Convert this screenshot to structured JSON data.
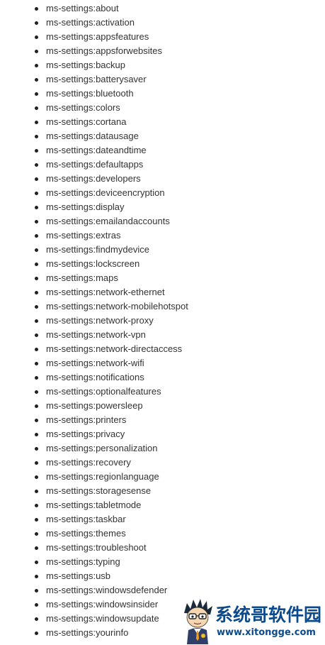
{
  "settings_uris": [
    "ms-settings:about",
    "ms-settings:activation",
    "ms-settings:appsfeatures",
    "ms-settings:appsforwebsites",
    "ms-settings:backup",
    "ms-settings:batterysaver",
    "ms-settings:bluetooth",
    "ms-settings:colors",
    "ms-settings:cortana",
    "ms-settings:datausage",
    "ms-settings:dateandtime",
    "ms-settings:defaultapps",
    "ms-settings:developers",
    "ms-settings:deviceencryption",
    "ms-settings:display",
    "ms-settings:emailandaccounts",
    "ms-settings:extras",
    "ms-settings:findmydevice",
    "ms-settings:lockscreen",
    "ms-settings:maps",
    "ms-settings:network-ethernet",
    "ms-settings:network-mobilehotspot",
    "ms-settings:network-proxy",
    "ms-settings:network-vpn",
    "ms-settings:network-directaccess",
    "ms-settings:network-wifi",
    "ms-settings:notifications",
    "ms-settings:optionalfeatures",
    "ms-settings:powersleep",
    "ms-settings:printers",
    "ms-settings:privacy",
    "ms-settings:personalization",
    "ms-settings:recovery",
    "ms-settings:regionlanguage",
    "ms-settings:storagesense",
    "ms-settings:tabletmode",
    "ms-settings:taskbar",
    "ms-settings:themes",
    "ms-settings:troubleshoot",
    "ms-settings:typing",
    "ms-settings:usb",
    "ms-settings:windowsdefender",
    "ms-settings:windowsinsider",
    "ms-settings:windowsupdate",
    "ms-settings:yourinfo"
  ],
  "watermark": {
    "brand_name": "系统哥软件园",
    "url": "www.xitongge.com",
    "icon": "mascot-logo-icon",
    "brand_color": "#0c4a8c"
  },
  "colors": {
    "text": "#333333",
    "bullet": "#222222",
    "background": "#ffffff"
  }
}
